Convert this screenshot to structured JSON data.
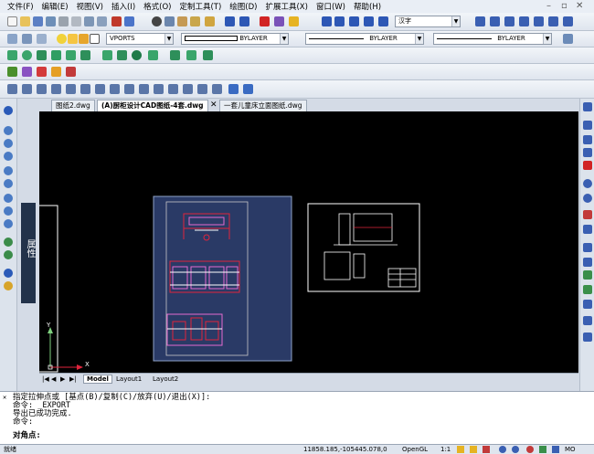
{
  "menu": {
    "items": [
      "文件(F)",
      "编辑(E)",
      "视图(V)",
      "插入(I)",
      "格式(O)",
      "定制工具(T)",
      "绘图(D)",
      "扩展工具(X)",
      "窗口(W)",
      "帮助(H)"
    ],
    "minimize": "–",
    "restore": "▫",
    "close": "✕"
  },
  "toolbar": {
    "text_style": "汉字",
    "view_name": "VPORTS",
    "color": "BYLAYER",
    "linetype": "BYLAYER",
    "lineweight": "BYLAYER"
  },
  "tabs": [
    {
      "label": "图纸2.dwg",
      "active": false
    },
    {
      "label": "(A)厨柜设计CAD图纸-4套.dwg",
      "active": true
    },
    {
      "label": "一套儿童床立面图纸.dwg",
      "active": false
    }
  ],
  "properties_tab": "属性",
  "layout_tabs": [
    "Model",
    "Layout1",
    "Layout2"
  ],
  "ucs": {
    "y": "Y",
    "x": "X"
  },
  "command": {
    "lines": [
      "指定拉伸点或 [基点(B)/复制(C)/放弃(U)/退出(X)]:",
      "命令: _EXPORT",
      "导出已成功完成.",
      "命令:"
    ],
    "prompt": "对角点:"
  },
  "status": {
    "ready": "就绪",
    "coords": "11858.185,-105445.078,0",
    "renderer": "OpenGL",
    "scale": "1:1",
    "mode": "MO"
  },
  "colors": {
    "canvas": "#000000",
    "sheet_blue": "#2a3a66",
    "drawing_red": "#e0243c",
    "drawing_pink": "#e46bd0"
  }
}
